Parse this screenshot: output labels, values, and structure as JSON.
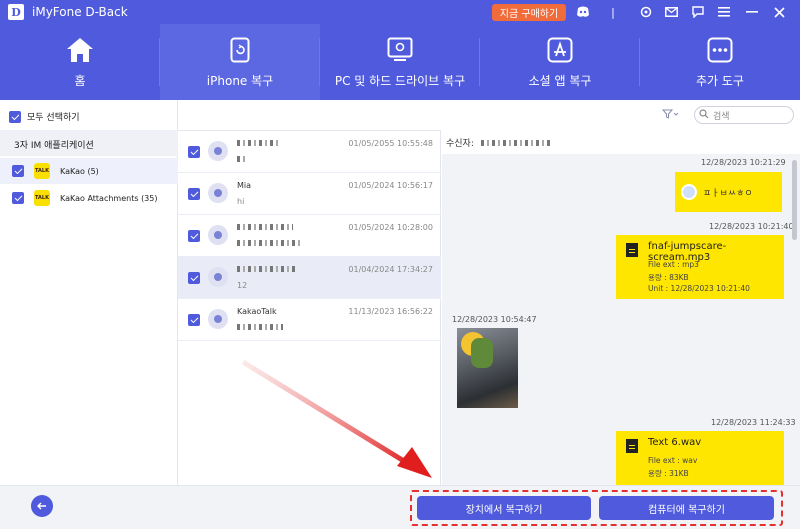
{
  "app": {
    "logo_letter": "D",
    "title": "iMyFone D-Back",
    "buy_label": "지금 구매하기"
  },
  "titlebar_icons": [
    "discord-icon",
    "settings-icon",
    "mail-icon",
    "chat-icon",
    "menu-icon",
    "minimize-icon",
    "close-icon"
  ],
  "nav": {
    "tabs": [
      {
        "label": "홈",
        "icon": "home-icon"
      },
      {
        "label": "iPhone 복구",
        "icon": "iphone-recovery-icon",
        "active": true
      },
      {
        "label": "PC 및 하드 드라이브 복구",
        "icon": "pc-drive-icon"
      },
      {
        "label": "소셜 앱 복구",
        "icon": "appstore-icon"
      },
      {
        "label": "추가 도구",
        "icon": "more-tools-icon"
      }
    ]
  },
  "sidebar": {
    "select_all": "모두 선택하기",
    "category": "3자 IM 애플리케이션",
    "sources": [
      {
        "label": "KaKao (5)",
        "selected": true
      },
      {
        "label": "KaKao Attachments (35)",
        "selected": false
      }
    ]
  },
  "toolbar": {
    "search_placeholder": "검색"
  },
  "messages": [
    {
      "name": "",
      "preview": "",
      "date": "01/05/2055 10:55:48",
      "selected": false
    },
    {
      "name": "Mia",
      "preview": "hi",
      "date": "01/05/2024 10:56:17",
      "selected": false
    },
    {
      "name": "",
      "preview": "",
      "date": "01/05/2024 10:28:00",
      "selected": false
    },
    {
      "name": "",
      "preview": "12",
      "date": "01/04/2024 17:34:27",
      "selected": true
    },
    {
      "name": "KakaoTalk",
      "preview": "",
      "date": "11/13/2023 16:56:22",
      "selected": false
    }
  ],
  "chat": {
    "recipient_label": "수신자:",
    "items": [
      {
        "time": "12/28/2023 10:21:29",
        "text": "ㅍㅏㅂㅆㅎㅇ"
      },
      {
        "time": "12/28/2023 10:21:40",
        "file": "fnaf-jumpscare-scream.mp3",
        "ext": "File ext : mp3",
        "size": "용량 : 83KB",
        "unit": "Unit : 12/28/2023 10:21:40"
      },
      {
        "time": "12/28/2023 10:54:47"
      },
      {
        "time": "12/28/2023 11:24:33",
        "file": "Text 6.wav",
        "ext": "File ext : wav",
        "size": "용량 : 31KB"
      }
    ]
  },
  "actions": {
    "device_label": "장치에서 복구하기",
    "computer_label": "컴퓨터에 복구하기"
  },
  "colors": {
    "brand": "#4f5bdc",
    "buy": "#f26b3a",
    "bubble": "#ffe600",
    "highlight": "#e53030"
  }
}
